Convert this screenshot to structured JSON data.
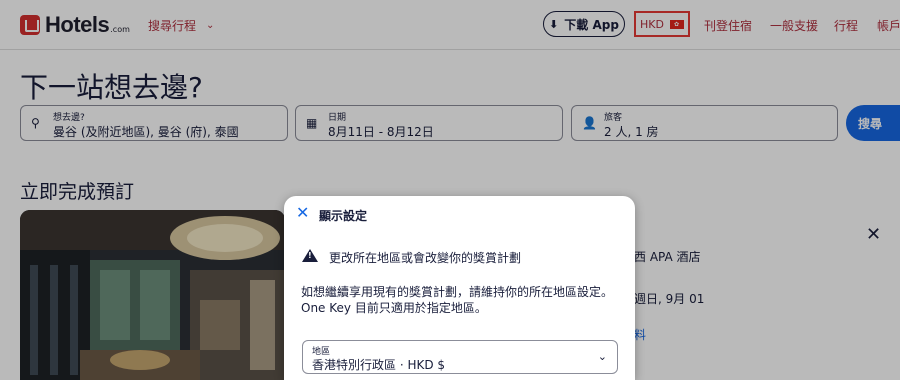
{
  "header": {
    "logo_text": "Hotels",
    "logo_sub": ".com",
    "trips_menu": "搜尋行程",
    "download_label": "下載 App",
    "currency": "HKD",
    "nav": [
      "刊登住宿",
      "一般支援",
      "行程",
      "帳戶"
    ]
  },
  "search": {
    "title": "下一站想去邊?",
    "destination_label": "想去邊?",
    "destination_value": "曼谷 (及附近地區), 曼谷 (府), 泰國",
    "date_label": "日期",
    "date_value": "8月11日 - 8月12日",
    "travelers_label": "旅客",
    "travelers_value": "2 人, 1 房",
    "search_button": "搜尋"
  },
  "booking": {
    "section_title": "立即完成預訂",
    "hotel_name": "西 APA 酒店",
    "hotel_date": "週日, 9月 01",
    "hotel_link": "料"
  },
  "modal": {
    "title": "顯示設定",
    "warning": "更改所在地區或會改變你的獎賞計劃",
    "body": "如想繼續享用現有的獎賞計劃，請維持你的所在地區設定。One Key 目前只適用於指定地區。",
    "region_label": "地區",
    "region_value": "香港特別行政區 · HKD $"
  },
  "colors": {
    "brand": "#d32f2f",
    "primary_blue": "#1668e3",
    "nav_text": "#b0303f",
    "highlight_border": "#e53935"
  }
}
